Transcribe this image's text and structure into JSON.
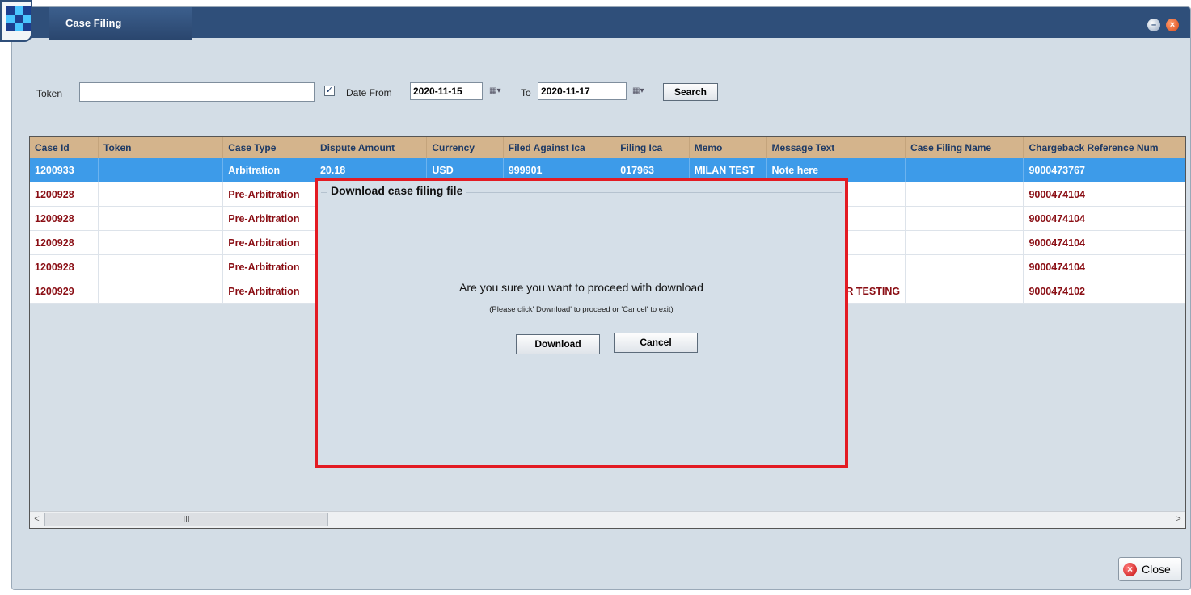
{
  "window": {
    "title": "Case Filing"
  },
  "filters": {
    "token_label": "Token",
    "token_value": "",
    "date_from_checked": true,
    "date_from_label": "Date From",
    "date_from": "2020-11-15",
    "to_label": "To",
    "date_to": "2020-11-17",
    "search_label": "Search"
  },
  "table": {
    "columns": [
      "Case Id",
      "Token",
      "Case Type",
      "Dispute Amount",
      "Currency",
      "Filed Against Ica",
      "Filing Ica",
      "Memo",
      "Message Text",
      "Case Filing Name",
      "Chargeback Reference Num"
    ],
    "rows": [
      [
        "1200933",
        "",
        "Arbitration",
        "20.18",
        "USD",
        "999901",
        "017963",
        "MILAN TEST",
        "Note here",
        "",
        "9000473767"
      ],
      [
        "1200928",
        "",
        "Pre-Arbitration",
        "",
        "",
        "",
        "",
        "",
        "",
        "",
        "9000474104"
      ],
      [
        "1200928",
        "",
        "Pre-Arbitration",
        "",
        "",
        "",
        "",
        "",
        "",
        "",
        "9000474104"
      ],
      [
        "1200928",
        "",
        "Pre-Arbitration",
        "",
        "",
        "",
        "",
        "",
        "",
        "",
        "9000474104"
      ],
      [
        "1200928",
        "",
        "Pre-Arbitration",
        "",
        "",
        "",
        "",
        "",
        "",
        "",
        "9000474104"
      ],
      [
        "1200929",
        "",
        "Pre-Arbitration",
        "",
        "",
        "",
        "",
        "",
        "R TESTING",
        "",
        "9000474102"
      ]
    ],
    "selected_row": 0
  },
  "dialog": {
    "title": "Download case filing file",
    "message": "Are you sure you want to proceed with download",
    "hint": "(Please click' Download' to proceed or 'Cancel' to exit)",
    "download_label": "Download",
    "cancel_label": "Cancel",
    "highlight_color": "#e31b23"
  },
  "footer": {
    "close_label": "Close"
  },
  "colors": {
    "titlebar": "#2f4f7a",
    "header": "#d4b48c",
    "selected": "#3d9be9",
    "row_text": "#8a0e14"
  }
}
